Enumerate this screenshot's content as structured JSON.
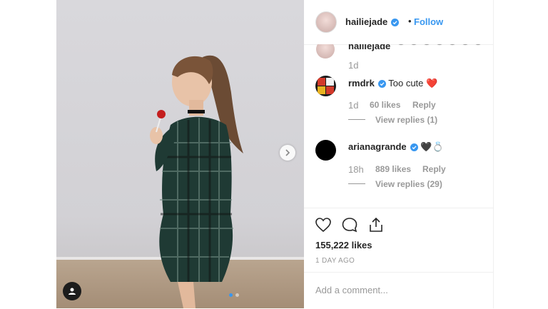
{
  "post": {
    "username": "hailiejade",
    "follow_label": "Follow",
    "separator": "•",
    "carousel_index": 1,
    "carousel_count": 2
  },
  "comments": {
    "partial": {
      "username": "hailiejade",
      "time": "1d"
    },
    "items": [
      {
        "username": "rmdrk",
        "text": "Too cute ❤️",
        "time": "1d",
        "likes": "60 likes",
        "reply_label": "Reply",
        "view_replies": "View replies (1)"
      },
      {
        "username": "arianagrande",
        "text": "🖤💍",
        "time": "18h",
        "likes": "889 likes",
        "reply_label": "Reply",
        "view_replies": "View replies (29)"
      }
    ]
  },
  "actions": {
    "like_count": "155,222 likes",
    "date": "1 DAY AGO",
    "comment_placeholder": "Add a comment..."
  },
  "icons": {
    "like": "heart-icon",
    "comment": "comment-bubble-icon",
    "share": "share-icon",
    "next": "chevron-right-icon",
    "tags": "user-tag-icon",
    "verified": "verified-badge-icon"
  },
  "colors": {
    "accent": "#3897f0",
    "muted": "#999999",
    "text": "#262626"
  }
}
